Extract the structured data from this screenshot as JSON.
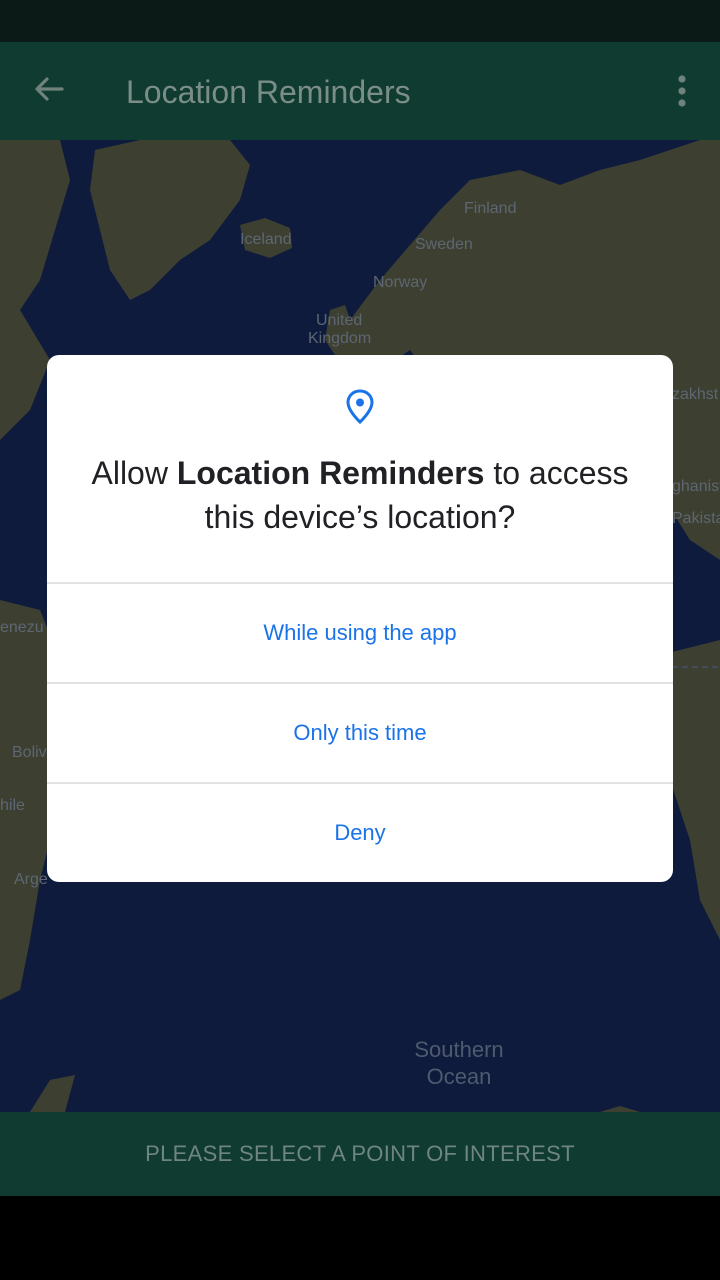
{
  "app_bar": {
    "title": "Location Reminders",
    "back_icon": "arrow-left-icon",
    "overflow_icon": "more-vert-icon"
  },
  "map": {
    "labels": {
      "finland": "Finland",
      "iceland": "Iceland",
      "sweden": "Sweden",
      "norway": "Norway",
      "uk_line1": "United",
      "uk_line2": "Kingdom",
      "kazakhstan": "zakhst",
      "afghanistan": "ghanist",
      "pakistan": "Pakista",
      "venezuela": "enezu",
      "bolivia": "Boliv",
      "chile": "hile",
      "argentina": "Arge",
      "southern_ocean_line1": "Southern",
      "southern_ocean_line2": "Ocean"
    }
  },
  "dialog": {
    "icon": "location-pin-icon",
    "title_prefix": "Allow ",
    "title_app": "Location Reminders",
    "title_suffix": " to access this device’s location?",
    "options": {
      "while_using": "While using the app",
      "only_this_time": "Only this time",
      "deny": "Deny"
    }
  },
  "bottom_banner": {
    "label": "PLEASE SELECT A POINT OF INTEREST"
  },
  "colors": {
    "accent": "#1a73e8",
    "app_bar": "#0f3b30",
    "map_water": "#0f1b3c",
    "map_land": "#3d4030"
  }
}
